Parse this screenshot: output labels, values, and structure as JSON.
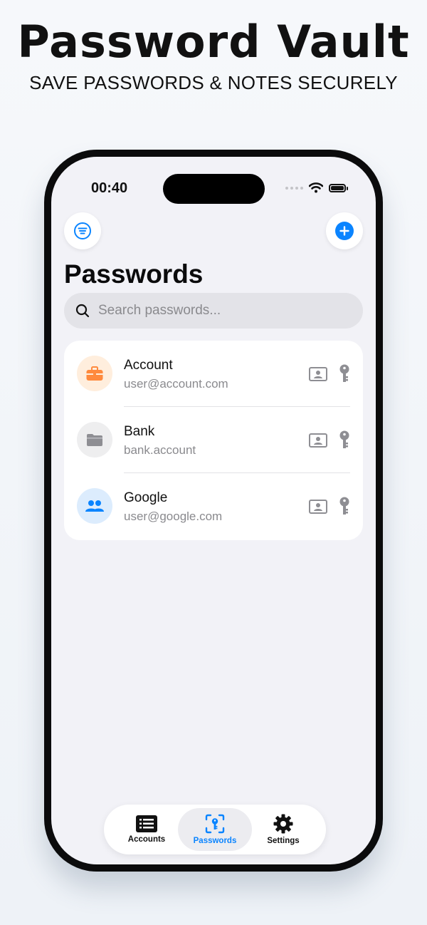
{
  "banner": {
    "headline": "Password Vault",
    "subhead": "SAVE PASSWORDS & NOTES SECURELY"
  },
  "status_bar": {
    "time": "00:40"
  },
  "toolbar": {
    "filter_icon": "filter-lines-icon",
    "add_icon": "plus-circle-icon",
    "accent_color": "#0a84ff"
  },
  "page": {
    "title": "Passwords"
  },
  "search": {
    "placeholder": "Search passwords...",
    "value": ""
  },
  "entries": [
    {
      "title": "Account",
      "subtitle": "user@account.com",
      "icon": "briefcase-icon",
      "icon_color": "#ff8a3d",
      "icon_bg": "#ffeedd"
    },
    {
      "title": "Bank",
      "subtitle": "bank.account",
      "icon": "folder-icon",
      "icon_color": "#8e8e93",
      "icon_bg": "#eeeeef"
    },
    {
      "title": "Google",
      "subtitle": "user@google.com",
      "icon": "people-icon",
      "icon_color": "#0a84ff",
      "icon_bg": "#dcecfd"
    }
  ],
  "row_actions": [
    "id-card-icon",
    "key-icon"
  ],
  "tabs": [
    {
      "label": "Accounts",
      "icon": "list-icon",
      "active": false
    },
    {
      "label": "Passwords",
      "icon": "key-scan-icon",
      "active": true
    },
    {
      "label": "Settings",
      "icon": "gear-icon",
      "active": false
    }
  ]
}
